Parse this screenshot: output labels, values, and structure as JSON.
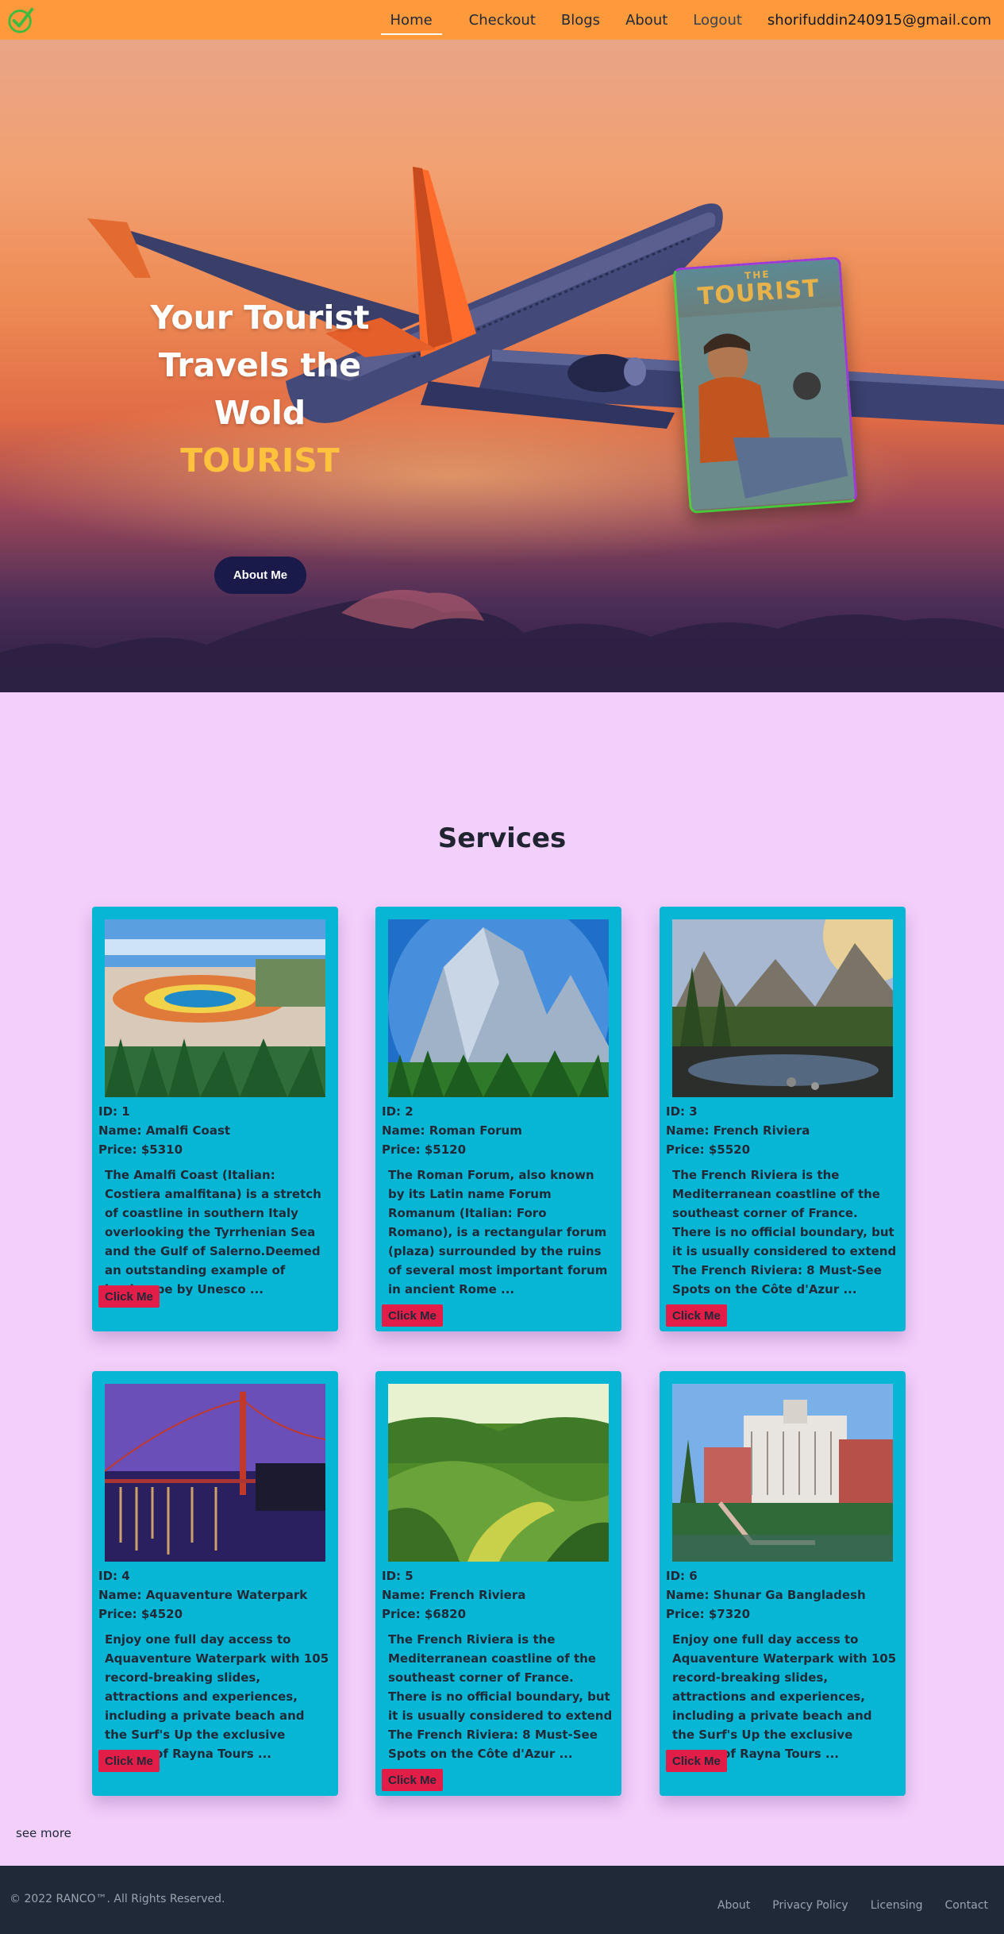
{
  "nav": {
    "home": "Home",
    "checkout": "Checkout",
    "blogs": "Blogs",
    "about": "About",
    "logout": "Logout",
    "email": "shorifuddin240915@gmail.com"
  },
  "hero": {
    "line1": "Your Tourist",
    "line2": "Travels the",
    "line3": "Wold",
    "accent": "TOURIST",
    "button": "About Me",
    "book_the": "THE",
    "book_title": "TOURIST"
  },
  "services": {
    "title": "Services",
    "see_more": "see more",
    "cards": [
      {
        "id": "ID: 1",
        "name": "Name: Amalfi Coast",
        "price": "Price: $5310",
        "desc": "The Amalfi Coast (Italian: Costiera amalfitana) is a stretch of coastline in southern Italy overlooking the Tyrrhenian Sea and the Gulf of Salerno.Deemed an outstanding example of landscape by Unesco ...",
        "button": "Click Me"
      },
      {
        "id": "ID: 2",
        "name": "Name: Roman Forum",
        "price": "Price: $5120",
        "desc": "The Roman Forum, also known by its Latin name Forum Romanum (Italian: Foro Romano), is a rectangular forum (plaza) surrounded by the ruins of several most important forum in ancient Rome ...",
        "button": "Click Me"
      },
      {
        "id": "ID: 3",
        "name": "Name: French Riviera",
        "price": "Price: $5520",
        "desc": "The French Riviera is the Mediterranean coastline of the southeast corner of France. There is no official boundary, but it is usually considered to extend The French Riviera: 8 Must-See Spots on the Côte d'Azur ...",
        "button": "Click Me"
      },
      {
        "id": "ID: 4",
        "name": "Name: Aquaventure Waterpark",
        "price": "Price: $4520",
        "desc": "Enjoy one full day access to Aquaventure Waterpark with 105 record-breaking slides, attractions and experiences, including a private beach and the Surf's Up the exclusive passes of Rayna Tours ...",
        "button": "Click Me"
      },
      {
        "id": "ID: 5",
        "name": "Name: French Riviera",
        "price": "Price: $6820",
        "desc": "The French Riviera is the Mediterranean coastline of the southeast corner of France. There is no official boundary, but it is usually considered to extend The French Riviera: 8 Must-See Spots on the Côte d'Azur ...",
        "button": "Click Me"
      },
      {
        "id": "ID: 6",
        "name": "Name: Shunar Ga Bangladesh",
        "price": "Price: $7320",
        "desc": "Enjoy one full day access to Aquaventure Waterpark with 105 record-breaking slides, attractions and experiences, including a private beach and the Surf's Up the exclusive passes of Rayna Tours ...",
        "button": "Click Me"
      }
    ]
  },
  "footer": {
    "copyright": "© 2022 RANCO™. All Rights Reserved.",
    "links": [
      "About",
      "Privacy Policy",
      "Licensing",
      "Contact"
    ]
  },
  "colors": {
    "navbar": "#ff9a3c",
    "page_bg": "#f3cffb",
    "card_bg": "#06b6d4",
    "button_red": "#e11d48",
    "hero_button": "#19194a",
    "accent_yellow": "#ffc23d",
    "footer_bg": "#1f2937"
  }
}
